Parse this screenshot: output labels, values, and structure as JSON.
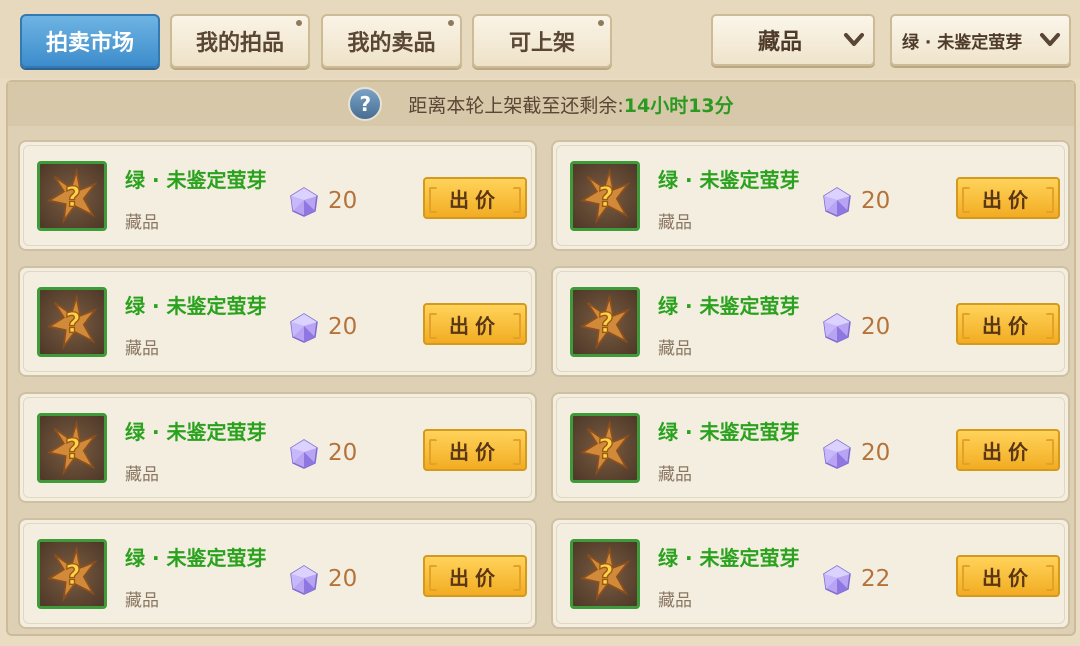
{
  "tabs": [
    {
      "label": "拍卖市场"
    },
    {
      "label": "我的拍品"
    },
    {
      "label": "我的卖品"
    },
    {
      "label": "可上架"
    }
  ],
  "filters": {
    "category": "藏品",
    "item": "绿 · 未鉴定萤芽"
  },
  "timer": {
    "label": "距离本轮上架截至还剩余:",
    "value": "14小时13分"
  },
  "colors": {
    "active_tab": "#3d8ccc",
    "item_name": "#2ba21e",
    "bid_button": "#f2ac22",
    "price": "#b4733a"
  },
  "listings": [
    {
      "name": "绿 · 未鉴定萤芽",
      "category": "藏品",
      "price": "20",
      "bid_label": "出价"
    },
    {
      "name": "绿 · 未鉴定萤芽",
      "category": "藏品",
      "price": "20",
      "bid_label": "出价"
    },
    {
      "name": "绿 · 未鉴定萤芽",
      "category": "藏品",
      "price": "20",
      "bid_label": "出价"
    },
    {
      "name": "绿 · 未鉴定萤芽",
      "category": "藏品",
      "price": "20",
      "bid_label": "出价"
    },
    {
      "name": "绿 · 未鉴定萤芽",
      "category": "藏品",
      "price": "20",
      "bid_label": "出价"
    },
    {
      "name": "绿 · 未鉴定萤芽",
      "category": "藏品",
      "price": "20",
      "bid_label": "出价"
    },
    {
      "name": "绿 · 未鉴定萤芽",
      "category": "藏品",
      "price": "20",
      "bid_label": "出价"
    },
    {
      "name": "绿 · 未鉴定萤芽",
      "category": "藏品",
      "price": "22",
      "bid_label": "出价"
    }
  ]
}
